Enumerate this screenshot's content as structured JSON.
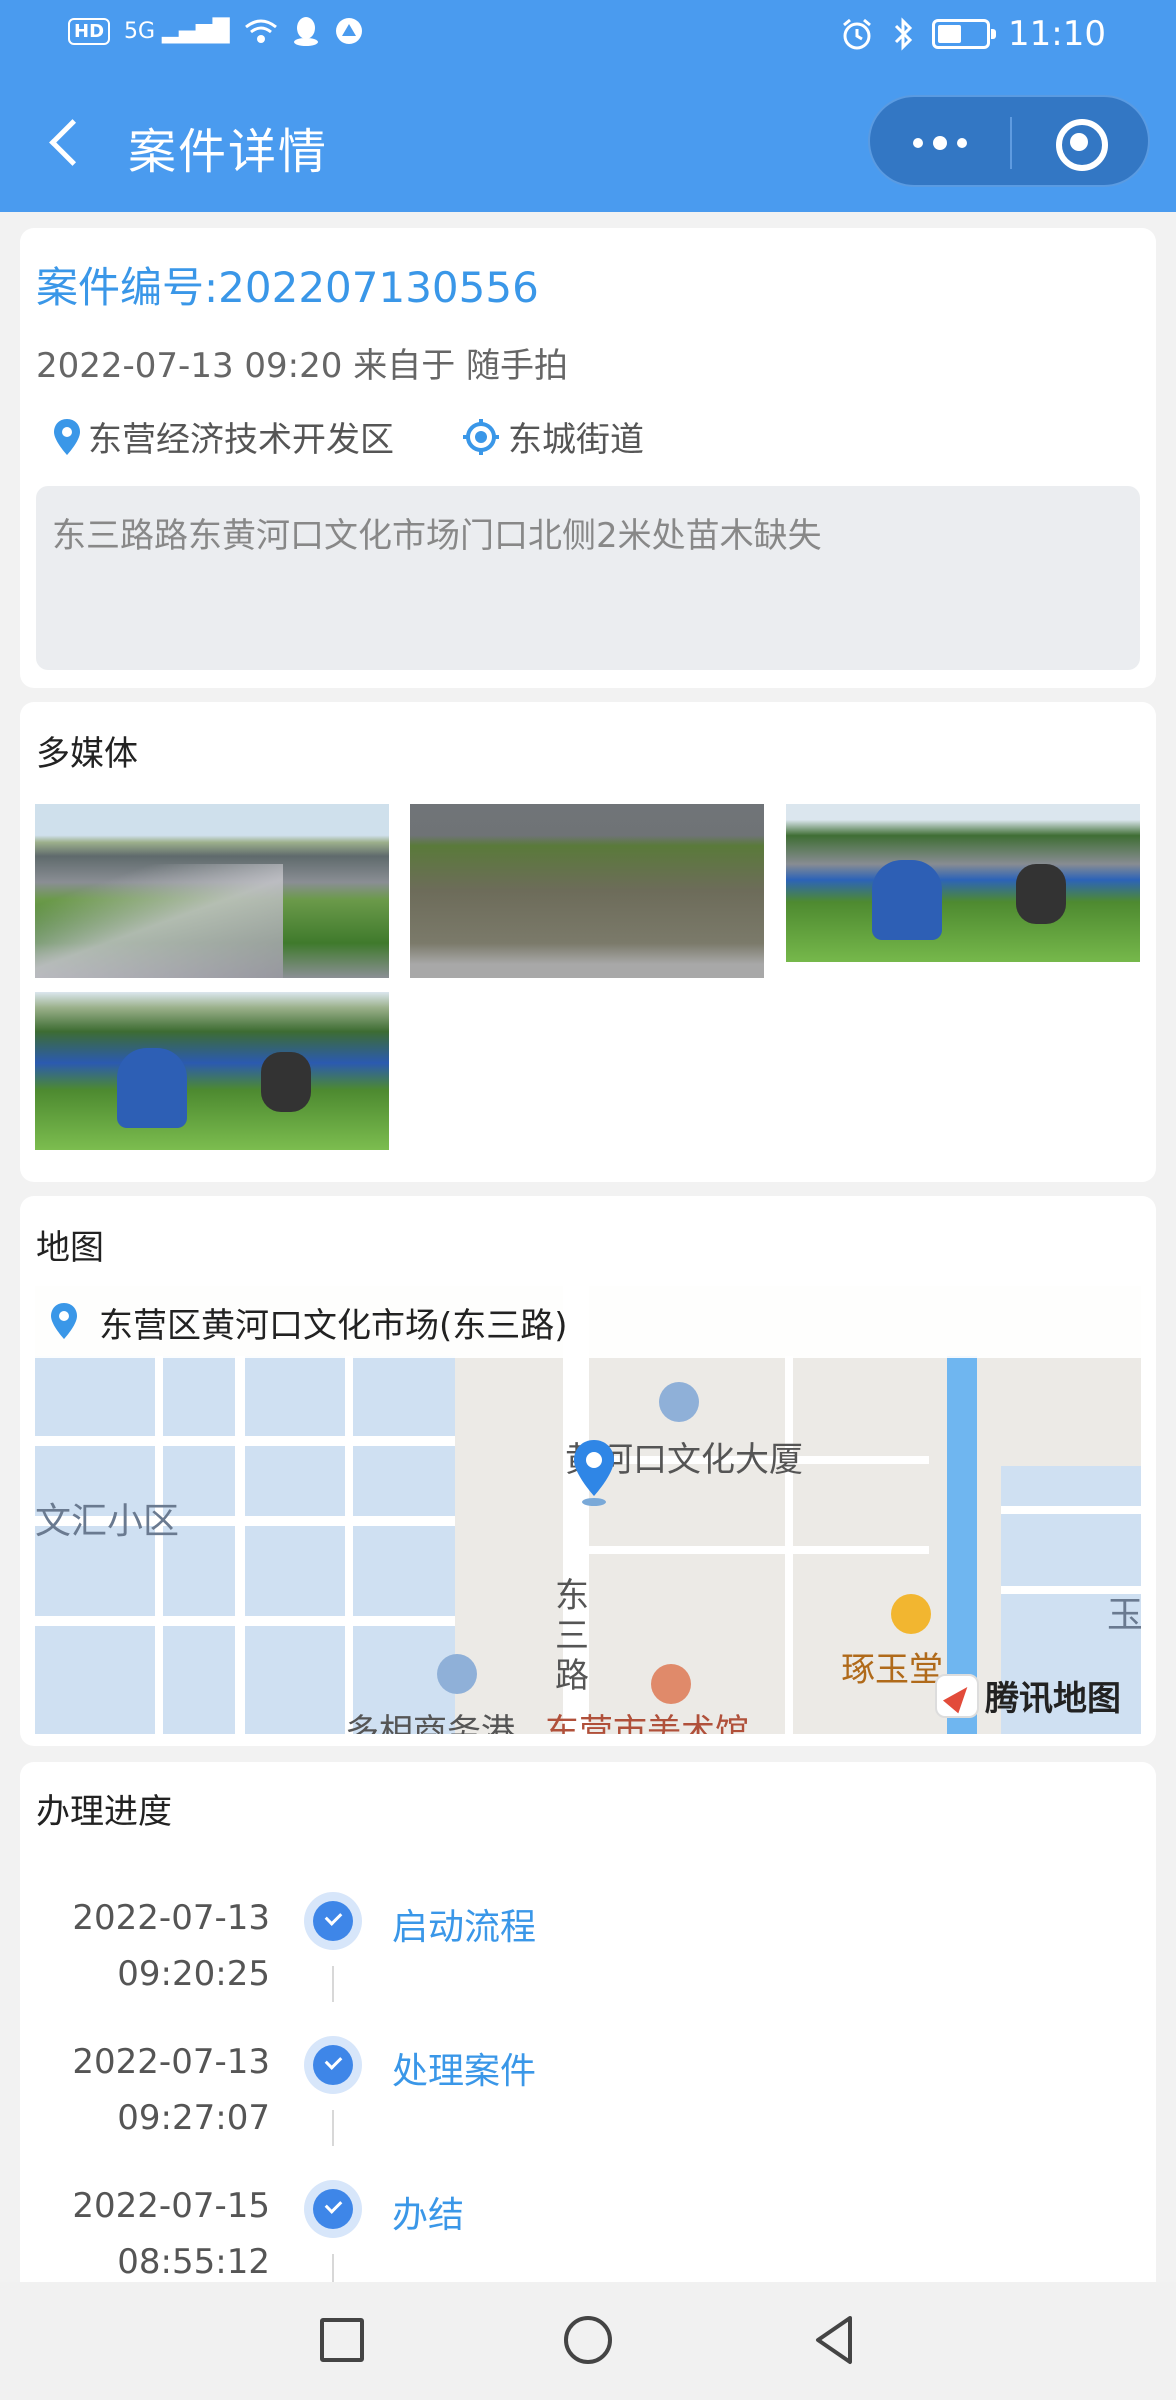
{
  "status_bar": {
    "left_icons": [
      "HD",
      "5G",
      "signal-icon",
      "wifi-icon",
      "qq-icon",
      "browser-icon"
    ],
    "time": "11:10",
    "battery_level": 0.5
  },
  "nav": {
    "title": "案件详情"
  },
  "case": {
    "number_label": "案件编号:202207130556",
    "meta": "2022-07-13 09:20 来自于 随手拍",
    "district": "东营经济技术开发区",
    "street": "东城街道",
    "description": "东三路路东黄河口文化市场门口北侧2米处苗木缺失"
  },
  "media": {
    "title": "多媒体",
    "count": 4
  },
  "map": {
    "title": "地图",
    "address": "东营区黄河口文化市场(东三路)",
    "labels": [
      "黄河口文化大厦",
      "文汇小区",
      "东三路",
      "琢玉堂",
      "多相商务港",
      "东营市美术馆",
      "玉"
    ],
    "brand": "腾讯地图"
  },
  "progress": {
    "title": "办理进度",
    "items": [
      {
        "date": "2022-07-13",
        "time": "09:20:25",
        "label": "启动流程"
      },
      {
        "date": "2022-07-13",
        "time": "09:27:07",
        "label": "处理案件"
      },
      {
        "date": "2022-07-15",
        "time": "08:55:12",
        "label": "办结"
      }
    ]
  },
  "colors": {
    "header": "#4a9bef",
    "accent": "#3a97e8",
    "capsule": "#3377c4"
  }
}
